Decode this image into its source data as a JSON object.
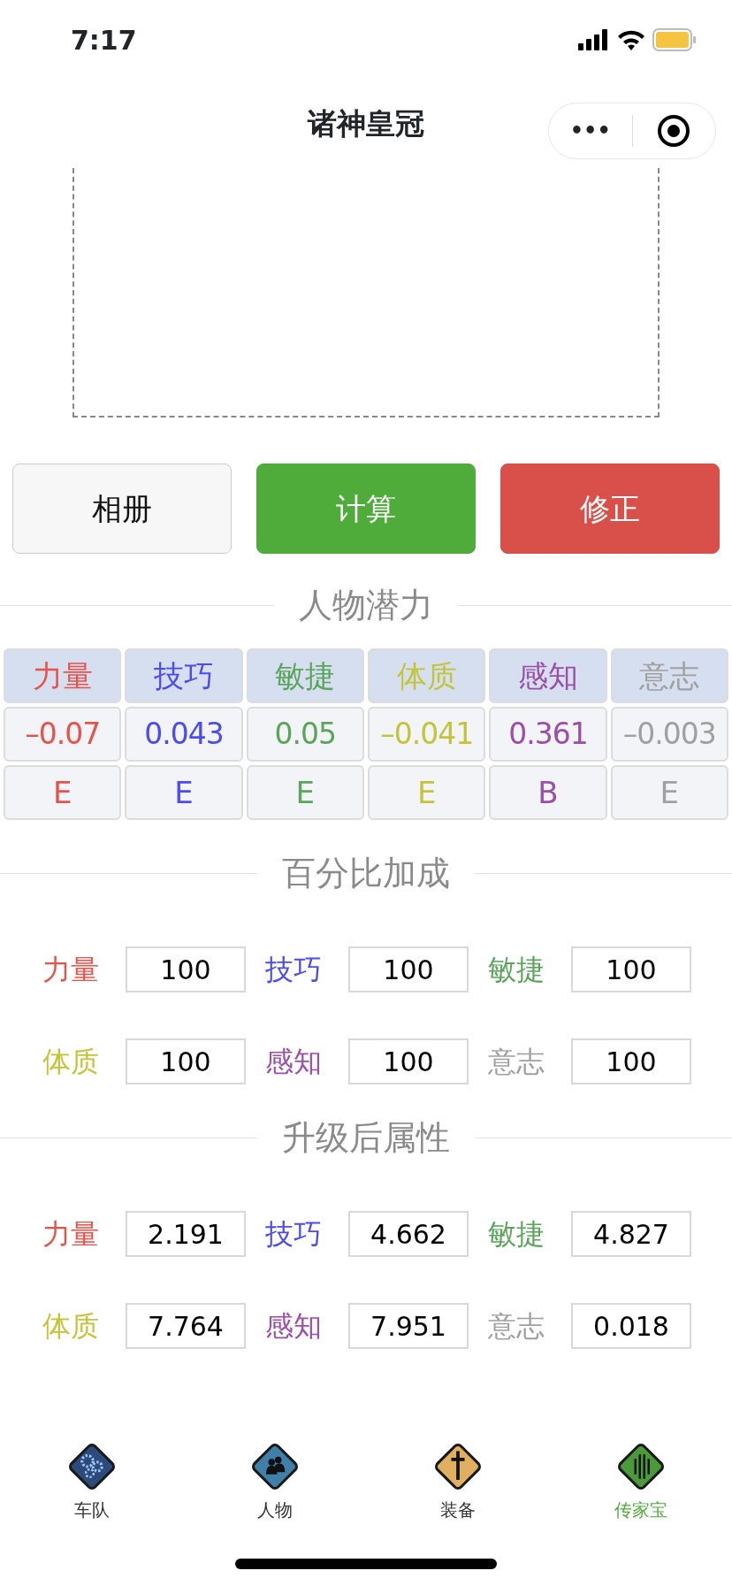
{
  "status_bar": {
    "time": "7:17"
  },
  "nav_bar": {
    "title": "诸神皇冠",
    "menu_icon": "•••"
  },
  "buttons": [
    {
      "label": "相册",
      "kind": "light"
    },
    {
      "label": "计算",
      "kind": "success"
    },
    {
      "label": "修正",
      "kind": "danger"
    }
  ],
  "potential": {
    "title": "人物潜力",
    "columns": [
      {
        "name": "力量",
        "value": "–0.07",
        "grade": "E",
        "color": "#e5534b"
      },
      {
        "name": "技巧",
        "value": "0.043",
        "grade": "E",
        "color": "#4b4bf0"
      },
      {
        "name": "敏捷",
        "value": "0.05",
        "grade": "E",
        "color": "#5ba55b"
      },
      {
        "name": "体质",
        "value": "–0.041",
        "grade": "E",
        "color": "#c4c43a"
      },
      {
        "name": "感知",
        "value": "0.361",
        "grade": "B",
        "color": "#9b4fa8"
      },
      {
        "name": "意志",
        "value": "–0.003",
        "grade": "E",
        "color": "#a0a0a0"
      }
    ]
  },
  "bonus": {
    "title": "百分比加成",
    "fields": [
      {
        "label": "力量",
        "value": "100",
        "color": "#e5534b"
      },
      {
        "label": "技巧",
        "value": "100",
        "color": "#4b4bf0"
      },
      {
        "label": "敏捷",
        "value": "100",
        "color": "#5ba55b"
      },
      {
        "label": "体质",
        "value": "100",
        "color": "#c4c43a"
      },
      {
        "label": "感知",
        "value": "100",
        "color": "#9b4fa8"
      },
      {
        "label": "意志",
        "value": "100",
        "color": "#a0a0a0"
      }
    ]
  },
  "upgraded": {
    "title": "升级后属性",
    "fields": [
      {
        "label": "力量",
        "value": "2.191",
        "color": "#e5534b"
      },
      {
        "label": "技巧",
        "value": "4.662",
        "color": "#4b4bf0"
      },
      {
        "label": "敏捷",
        "value": "4.827",
        "color": "#5ba55b"
      },
      {
        "label": "体质",
        "value": "7.764",
        "color": "#c4c43a"
      },
      {
        "label": "感知",
        "value": "7.951",
        "color": "#9b4fa8"
      },
      {
        "label": "意志",
        "value": "0.018",
        "color": "#a0a0a0"
      }
    ]
  },
  "tab_bar": [
    {
      "label": "车队",
      "kind": "gears",
      "selected": false
    },
    {
      "label": "人物",
      "kind": "people",
      "selected": false
    },
    {
      "label": "装备",
      "kind": "sword",
      "selected": false
    },
    {
      "label": "传家宝",
      "kind": "bars",
      "selected": true
    }
  ]
}
